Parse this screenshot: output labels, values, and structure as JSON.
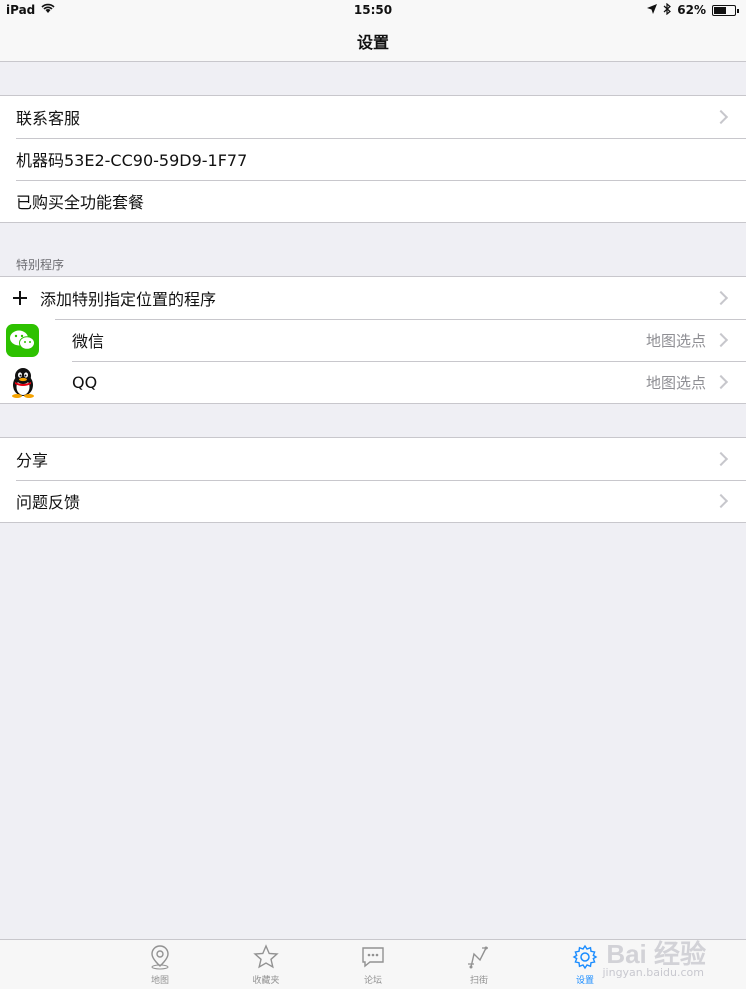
{
  "status_bar": {
    "device": "iPad",
    "time": "15:50",
    "battery": "62%",
    "battery_level": 0.62
  },
  "nav": {
    "title": "设置"
  },
  "group1": [
    {
      "label": "联系客服",
      "chevron": true
    },
    {
      "label": "机器码53E2-CC90-59D9-1F77",
      "chevron": false
    },
    {
      "label": "已购买全功能套餐",
      "chevron": false
    }
  ],
  "section_header": "特别程序",
  "group2": {
    "add_label": "添加特别指定位置的程序",
    "apps": [
      {
        "name": "微信",
        "detail": "地图选点",
        "icon": "wechat-icon"
      },
      {
        "name": "QQ",
        "detail": "地图选点",
        "icon": "qq-icon"
      }
    ]
  },
  "group3": [
    {
      "label": "分享"
    },
    {
      "label": "问题反馈"
    }
  ],
  "tabs": [
    {
      "label": "地图",
      "icon": "map-pin-icon",
      "active": false
    },
    {
      "label": "收藏夹",
      "icon": "star-icon",
      "active": false
    },
    {
      "label": "论坛",
      "icon": "chat-icon",
      "active": false
    },
    {
      "label": "扫街",
      "icon": "route-icon",
      "active": false
    },
    {
      "label": "设置",
      "icon": "gear-icon",
      "active": true
    }
  ],
  "colors": {
    "accent": "#1a8cff",
    "background": "#efeff4",
    "wechat": "#2dc100"
  },
  "watermark": {
    "text": "Bai 经验",
    "url": "jingyan.baidu.com"
  }
}
